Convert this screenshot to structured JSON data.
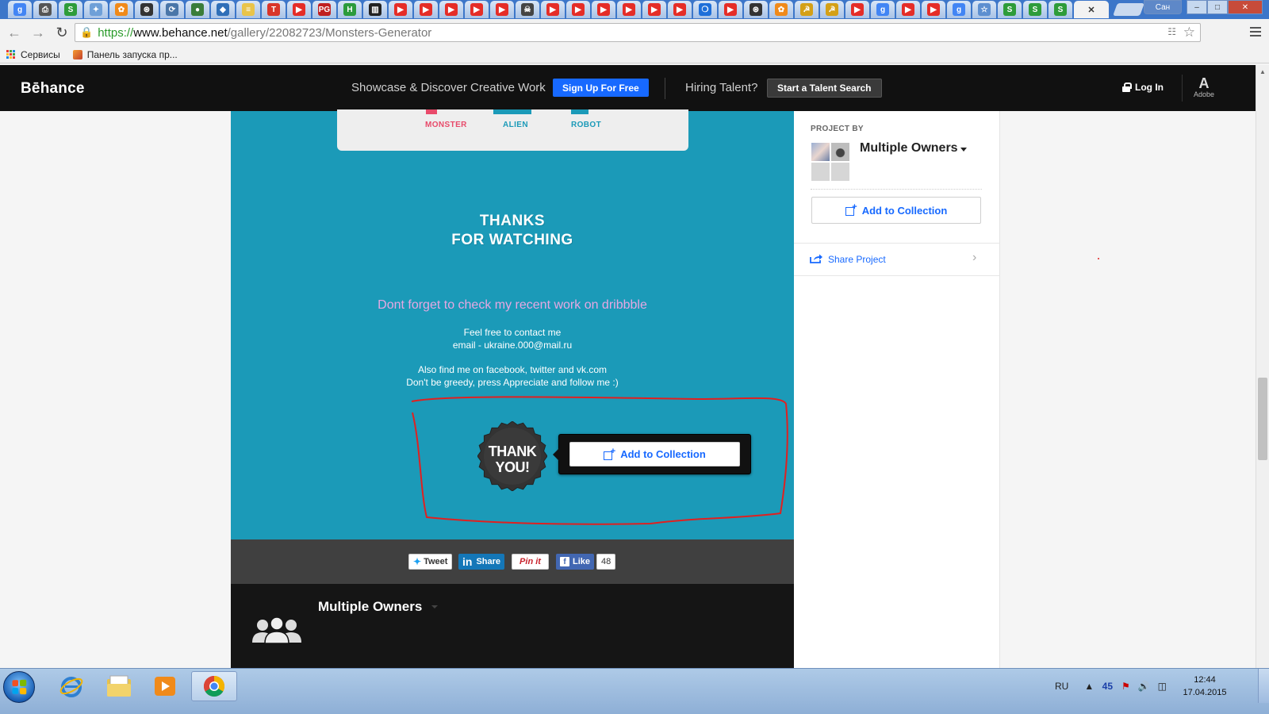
{
  "browser": {
    "window_user": "Сан",
    "window_min": "–",
    "window_max": "□",
    "window_close": "✕",
    "tab_icons": [
      "g",
      "print",
      "S",
      "puzzle",
      "gear",
      "film",
      "vk",
      "tracker",
      "blue",
      "note",
      "T",
      "youtube",
      "PG",
      "H",
      "chart",
      "youtube",
      "youtube",
      "youtube",
      "youtube",
      "youtube",
      "skull",
      "youtube",
      "youtube",
      "youtube",
      "youtube",
      "youtube",
      "youtube",
      "drop",
      "youtube",
      "film",
      "gear",
      "ussr",
      "ussr",
      "youtube",
      "g",
      "youtube",
      "youtube",
      "g",
      "star",
      "S",
      "S",
      "S"
    ],
    "active_tab_close": "✕",
    "url_scheme": "https://",
    "url_host": "www.behance.net",
    "url_path": "/gallery/22082723/Monsters-Generator",
    "bookmarks": [
      {
        "label": "Сервисы",
        "icon": "apps-icon"
      },
      {
        "label": "Панель запуска пр...",
        "icon": "launch-icon"
      }
    ]
  },
  "behance": {
    "logo": "Bēhance",
    "tagline": "Showcase & Discover Creative Work",
    "signup": "Sign Up For Free",
    "hiring": "Hiring Talent?",
    "talent_search": "Start a Talent Search",
    "login": "Log In",
    "adobe_mark": "A",
    "adobe_label": "Adobe",
    "accent": "#1769ff"
  },
  "project": {
    "background": "#1b9ab8",
    "preview_labels": [
      "MONSTER",
      "ALIEN",
      "ROBOT"
    ],
    "thanks_line1": "THANKS",
    "thanks_line2": "FOR WATCHING",
    "dribbble_note": "Dont forget to check my recent work on dribbble",
    "contact_line1": "Feel free to contact me",
    "contact_line2": "email - ukraine.000@mail.ru",
    "social_line1": "Also find me on facebook, twitter and vk.com",
    "social_line2": "Don't be greedy, press Appreciate and follow me :)",
    "badge_line1": "THANK",
    "badge_line2": "YOU!",
    "add_to_collection": "Add to Collection"
  },
  "social": {
    "tweet": "Tweet",
    "linkedin_share": "Share",
    "pinit": "Pin it",
    "like": "Like",
    "like_count": "48"
  },
  "owners_footer": {
    "name": "Multiple Owners"
  },
  "sidebar": {
    "project_by": "PROJECT BY",
    "owners": "Multiple Owners",
    "add_to_collection": "Add to Collection",
    "share_project": "Share Project"
  },
  "taskbar": {
    "apps": [
      "internet-explorer",
      "file-explorer",
      "media-player",
      "chrome"
    ],
    "language": "RU",
    "tray_icons": [
      "arrow-up-icon",
      "ms-icon",
      "flag-icon",
      "volume-icon",
      "network-icon"
    ],
    "time": "12:44",
    "date": "17.04.2015"
  }
}
